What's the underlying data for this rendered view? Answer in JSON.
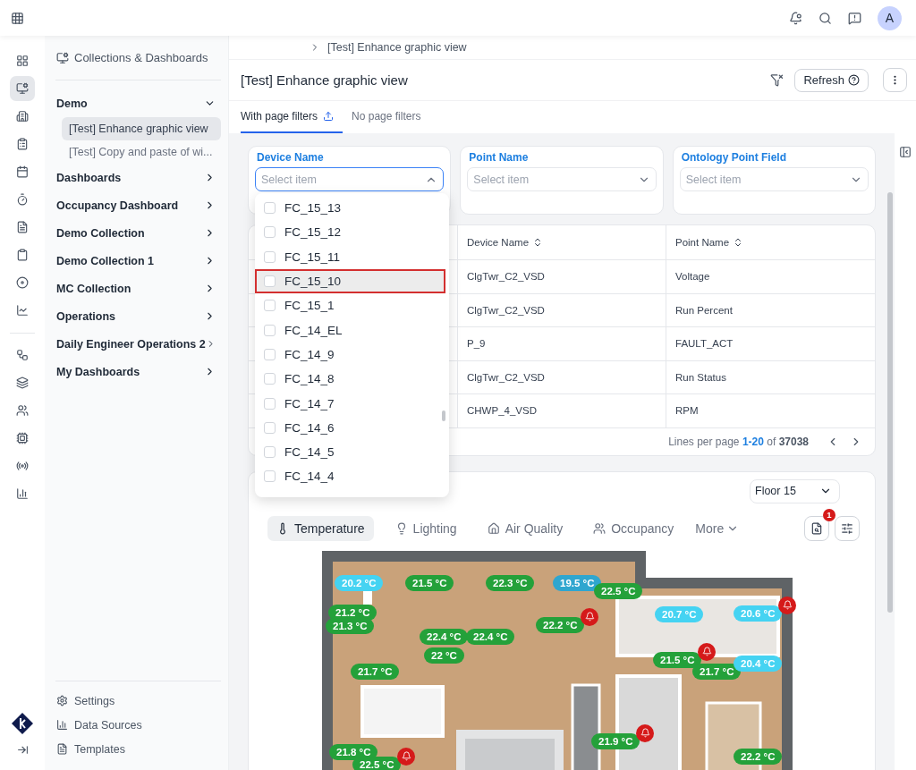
{
  "topbar": {
    "avatar": "A"
  },
  "rail_items": [
    {
      "kind": "overview",
      "selected": false
    },
    {
      "kind": "dashboards",
      "selected": true
    },
    {
      "kind": "buildings",
      "selected": false
    },
    {
      "kind": "reports",
      "selected": false
    },
    {
      "kind": "calendar",
      "selected": false
    },
    {
      "kind": "timer",
      "selected": false
    },
    {
      "kind": "file",
      "selected": false
    },
    {
      "kind": "clipboard",
      "selected": false
    },
    {
      "kind": "disc",
      "selected": false
    },
    {
      "kind": "trend",
      "selected": false
    },
    {
      "kind": "workflow",
      "selected": false
    },
    {
      "kind": "layers",
      "selected": false
    },
    {
      "kind": "users",
      "selected": false
    },
    {
      "kind": "chip",
      "selected": false
    },
    {
      "kind": "signal",
      "selected": false
    },
    {
      "kind": "chart",
      "selected": false
    }
  ],
  "sidebar": {
    "title": "Collections & Dashboards",
    "items": [
      {
        "label": "Demo",
        "expanded": true,
        "children": [
          {
            "label": "[Test] Enhance graphic view",
            "selected": true
          },
          {
            "label": "[Test] Copy and paste of wi...",
            "selected": false
          }
        ]
      },
      {
        "label": "Dashboards",
        "expanded": false
      },
      {
        "label": "Occupancy Dashboard",
        "expanded": false
      },
      {
        "label": "Demo Collection",
        "expanded": false
      },
      {
        "label": "Demo Collection 1",
        "expanded": false
      },
      {
        "label": "MC Collection",
        "expanded": false
      },
      {
        "label": "Operations",
        "expanded": false
      },
      {
        "label": "Daily Engineer Operations 2",
        "expanded": false
      },
      {
        "label": "My Dashboards",
        "expanded": false
      }
    ],
    "footer": [
      {
        "kind": "settings",
        "label": "Settings"
      },
      {
        "kind": "sources",
        "label": "Data Sources"
      },
      {
        "kind": "templates",
        "label": "Templates"
      }
    ]
  },
  "breadcrumb": "[Test] Enhance graphic view",
  "page_title": "[Test] Enhance graphic view",
  "refresh_button": "Refresh",
  "tabs": [
    {
      "label": "With page filters",
      "selected": true
    },
    {
      "label": "No page filters",
      "selected": false
    }
  ],
  "filters": [
    {
      "label": "Device Name",
      "placeholder": "Select item",
      "open": true
    },
    {
      "label": "Point Name",
      "placeholder": "Select item",
      "open": false
    },
    {
      "label": "Ontology Point Field",
      "placeholder": "Select item",
      "open": false
    }
  ],
  "dropdown_items": [
    {
      "label": "FC_15_13",
      "checked": false,
      "highlighted": false
    },
    {
      "label": "FC_15_12",
      "checked": false,
      "highlighted": false
    },
    {
      "label": "FC_15_11",
      "checked": false,
      "highlighted": false
    },
    {
      "label": "FC_15_10",
      "checked": false,
      "highlighted": true
    },
    {
      "label": "FC_15_1",
      "checked": false,
      "highlighted": false
    },
    {
      "label": "FC_14_EL",
      "checked": false,
      "highlighted": false
    },
    {
      "label": "FC_14_9",
      "checked": false,
      "highlighted": false
    },
    {
      "label": "FC_14_8",
      "checked": false,
      "highlighted": false
    },
    {
      "label": "FC_14_7",
      "checked": false,
      "highlighted": false
    },
    {
      "label": "FC_14_6",
      "checked": false,
      "highlighted": false
    },
    {
      "label": "FC_14_5",
      "checked": false,
      "highlighted": false
    },
    {
      "label": "FC_14_4",
      "checked": false,
      "highlighted": false
    }
  ],
  "table": {
    "columns": [
      "Device Name",
      "Point Name"
    ],
    "rows": [
      [
        "ClgTwr_C2_VSD",
        "Voltage"
      ],
      [
        "ClgTwr_C2_VSD",
        "Run Percent"
      ],
      [
        "P_9",
        "FAULT_ACT"
      ],
      [
        "ClgTwr_C2_VSD",
        "Run Status"
      ],
      [
        "CHWP_4_VSD",
        "RPM"
      ]
    ],
    "pager": {
      "label": "Lines per page",
      "range": "1-20",
      "of": "of",
      "total": "37038"
    }
  },
  "floor": {
    "select": "Floor 15",
    "tabs": [
      {
        "kind": "temperature",
        "label": "Temperature",
        "selected": true
      },
      {
        "kind": "lighting",
        "label": "Lighting",
        "selected": false
      },
      {
        "kind": "air",
        "label": "Air Quality",
        "selected": false
      },
      {
        "kind": "occupancy",
        "label": "Occupancy",
        "selected": false
      }
    ],
    "more": "More",
    "alerts_badge": "1",
    "sensors": [
      {
        "reading": "20.2 °C",
        "kind": "cool",
        "alarm": false
      },
      {
        "reading": "21.5 °C",
        "kind": "normal",
        "alarm": false
      },
      {
        "reading": "22.3 °C",
        "kind": "normal",
        "alarm": false
      },
      {
        "reading": "19.5 °C",
        "kind": "cold",
        "alarm": false
      },
      {
        "reading": "22.5 °C",
        "kind": "normal",
        "alarm": false
      },
      {
        "reading": "21.2 °C",
        "kind": "normal",
        "alarm": false
      },
      {
        "reading": "21.3 °C",
        "kind": "normal",
        "alarm": false
      },
      {
        "reading": "22.2 °C",
        "kind": "normal",
        "alarm": true
      },
      {
        "reading": "22.4 °C",
        "kind": "normal",
        "alarm": false
      },
      {
        "reading": "22.4 °C",
        "kind": "normal",
        "alarm": false
      },
      {
        "reading": "22 °C",
        "kind": "normal",
        "alarm": false
      },
      {
        "reading": "20.7 °C",
        "kind": "cool",
        "alarm": false
      },
      {
        "reading": "20.6 °C",
        "kind": "cool",
        "alarm": true
      },
      {
        "reading": "21.7 °C",
        "kind": "normal",
        "alarm": false
      },
      {
        "reading": "21.5 °C",
        "kind": "normal",
        "alarm": true
      },
      {
        "reading": "21.7 °C",
        "kind": "normal",
        "alarm": false
      },
      {
        "reading": "20.4 °C",
        "kind": "cool",
        "alarm": false
      },
      {
        "reading": "21.8 °C",
        "kind": "normal",
        "alarm": false
      },
      {
        "reading": "22.5 °C",
        "kind": "normal",
        "alarm": true
      },
      {
        "reading": "21.9 °C",
        "kind": "normal",
        "alarm": true
      },
      {
        "reading": "22.2 °C",
        "kind": "normal",
        "alarm": false
      }
    ]
  }
}
